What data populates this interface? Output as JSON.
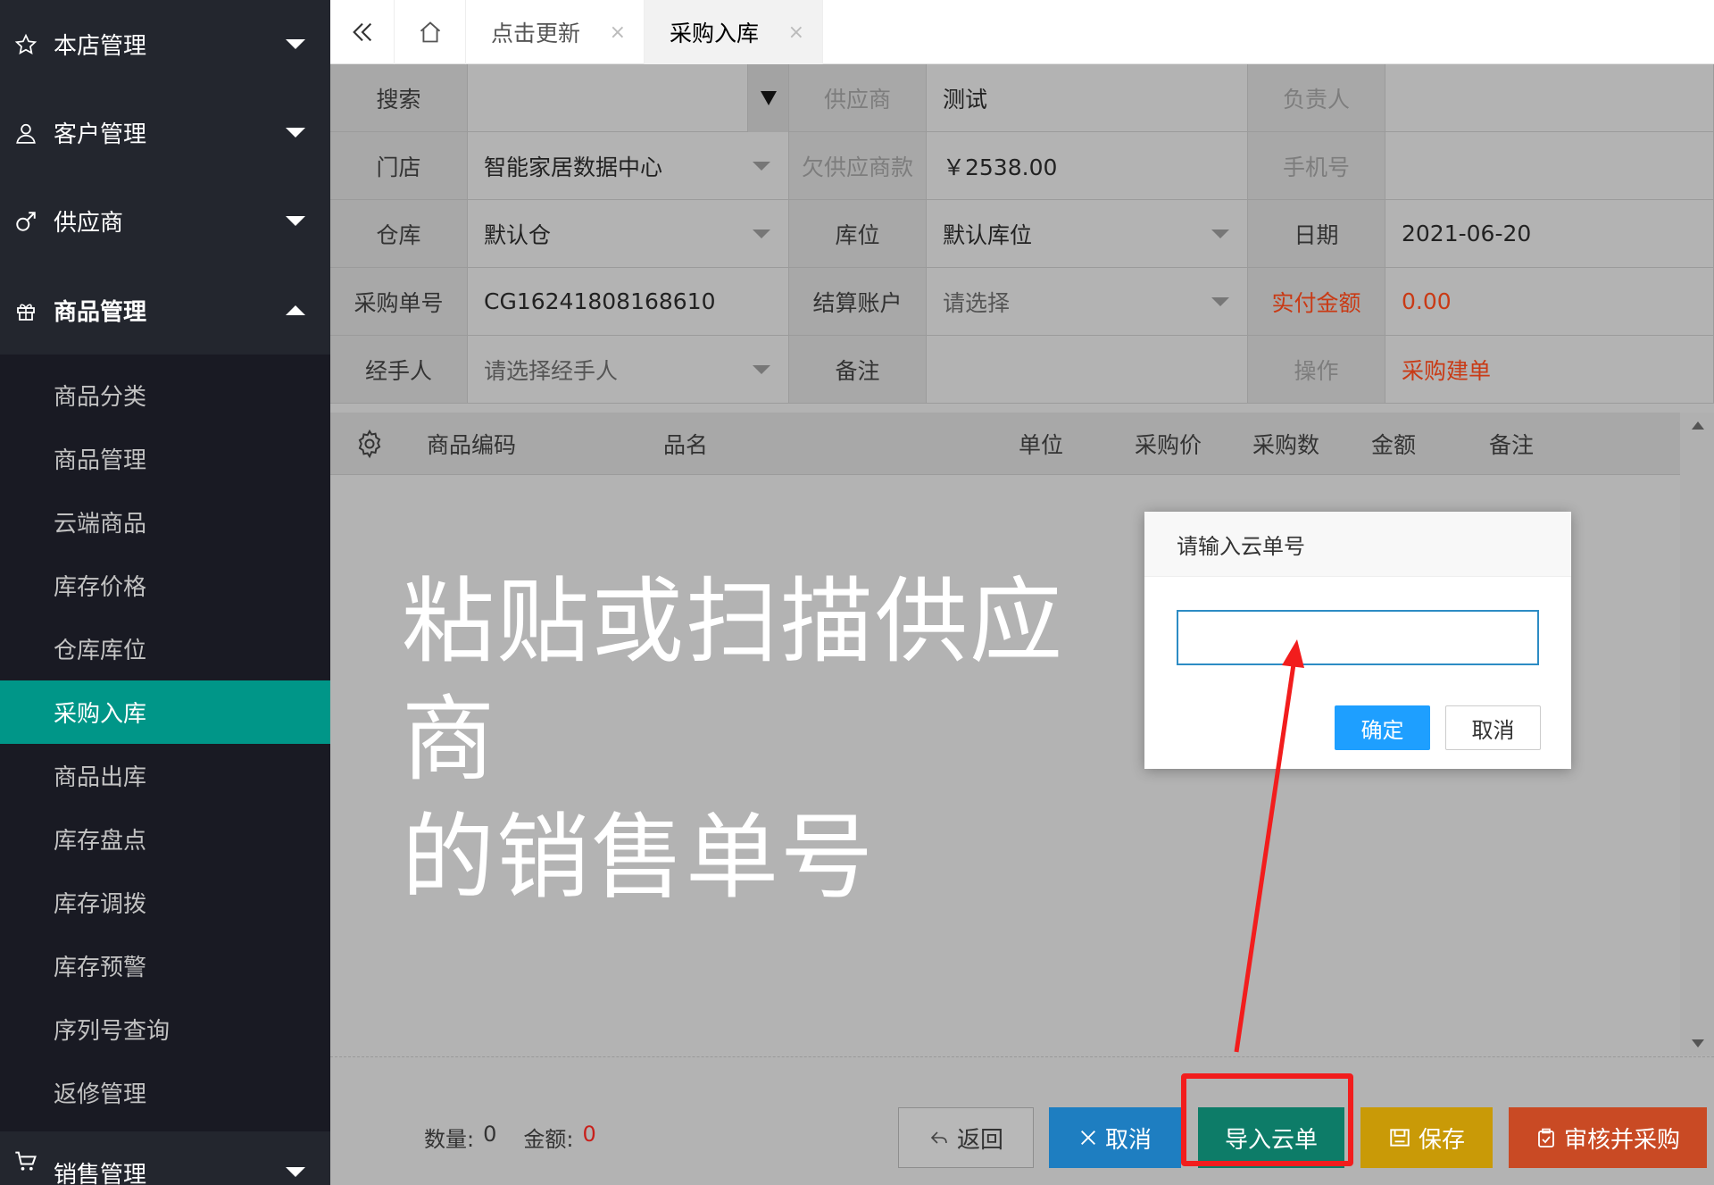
{
  "sidebar": {
    "groups": [
      {
        "label": "本店管理",
        "icon": "star-icon"
      },
      {
        "label": "客户管理",
        "icon": "user-icon"
      },
      {
        "label": "供应商",
        "icon": "male-icon"
      },
      {
        "label": "商品管理",
        "icon": "gift-icon"
      },
      {
        "label": "销售管理",
        "icon": "cart-icon"
      }
    ],
    "sub_items": [
      "商品分类",
      "商品管理",
      "云端商品",
      "库存价格",
      "仓库库位",
      "采购入库",
      "商品出库",
      "库存盘点",
      "库存调拨",
      "库存预警",
      "序列号查询",
      "返修管理"
    ],
    "active_item": "采购入库"
  },
  "tabs": {
    "items": [
      {
        "label": "点击更新",
        "close": "×"
      },
      {
        "label": "采购入库",
        "close": "×"
      }
    ]
  },
  "form": {
    "search_label": "搜索",
    "supplier_label": "供应商",
    "supplier_value": "测试",
    "owner_label": "负责人",
    "store_label": "门店",
    "store_value": "智能家居数据中心",
    "debt_label": "欠供应商款",
    "debt_value": "￥2538.00",
    "phone_label": "手机号",
    "warehouse_label": "仓库",
    "warehouse_value": "默认仓",
    "location_label": "库位",
    "location_value": "默认库位",
    "date_label": "日期",
    "date_value": "2021-06-20",
    "order_no_label": "采购单号",
    "order_no_value": "CG16241808168610",
    "account_label": "结算账户",
    "account_placeholder": "请选择",
    "paid_label": "实付金额",
    "paid_value": "0.00",
    "handler_label": "经手人",
    "handler_placeholder": "请选择经手人",
    "remark_label": "备注",
    "action_label": "操作",
    "action_link": "采购建单"
  },
  "table": {
    "columns": [
      "商品编码",
      "品名",
      "单位",
      "采购价",
      "采购数",
      "金额",
      "备注"
    ]
  },
  "overlay_text": {
    "line1": "粘贴或扫描供应商",
    "line2": "的销售单号"
  },
  "summary": {
    "qty_label": "数量:",
    "qty_value": "0",
    "amount_label": "金额:",
    "amount_value": "0"
  },
  "buttons": {
    "back": "返回",
    "cancel": "取消",
    "import": "导入云单",
    "save": "保存",
    "audit": "审核并采购"
  },
  "dialog": {
    "title": "请输入云单号",
    "input_value": "",
    "ok": "确定",
    "cancel": "取消"
  },
  "colors": {
    "sidebar_bg": "#23262e",
    "active_green": "#009688",
    "highlight_red": "#f21d1d",
    "primary_blue": "#1e9fff"
  }
}
